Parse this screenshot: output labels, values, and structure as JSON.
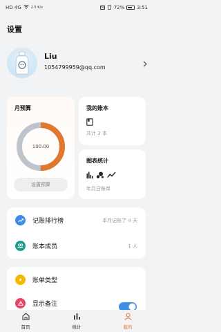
{
  "status_bar": {
    "left_text": "HD 4G",
    "speed": "2.5 K/s",
    "battery_pct": "72%",
    "time": "3:51"
  },
  "page_title": "设置",
  "profile": {
    "name": "Liu",
    "email": "1054799959@qq.com"
  },
  "budget_card": {
    "title": "月预算",
    "center_value": "100.00",
    "button": "设置预算",
    "used_fraction": 0.5
  },
  "books_card": {
    "title": "我的账本",
    "count_text": "共计 3 本"
  },
  "charts_card": {
    "title": "图表统计",
    "subtitle": "年月日账单"
  },
  "list1": [
    {
      "label": "记账排行榜",
      "value": "本月记账了 4 天",
      "icon": "ranking-icon",
      "color": "#3f8de6"
    },
    {
      "label": "账本成员",
      "value": "1 人",
      "icon": "members-icon",
      "color": "#1e9b8c"
    }
  ],
  "list2": [
    {
      "label": "账单类型",
      "icon": "bill-type-icon",
      "color": "#f5b800"
    },
    {
      "label": "显示备注",
      "icon": "note-icon",
      "color": "#e54666"
    }
  ],
  "tabs": [
    {
      "label": "首页",
      "icon": "home-icon",
      "active": false
    },
    {
      "label": "统计",
      "icon": "stats-icon",
      "active": false
    },
    {
      "label": "我的",
      "icon": "profile-icon",
      "active": true
    }
  ],
  "colors": {
    "accent": "#e0772e",
    "ring_track": "#bdc4cb",
    "background": "#f2f3f5"
  }
}
